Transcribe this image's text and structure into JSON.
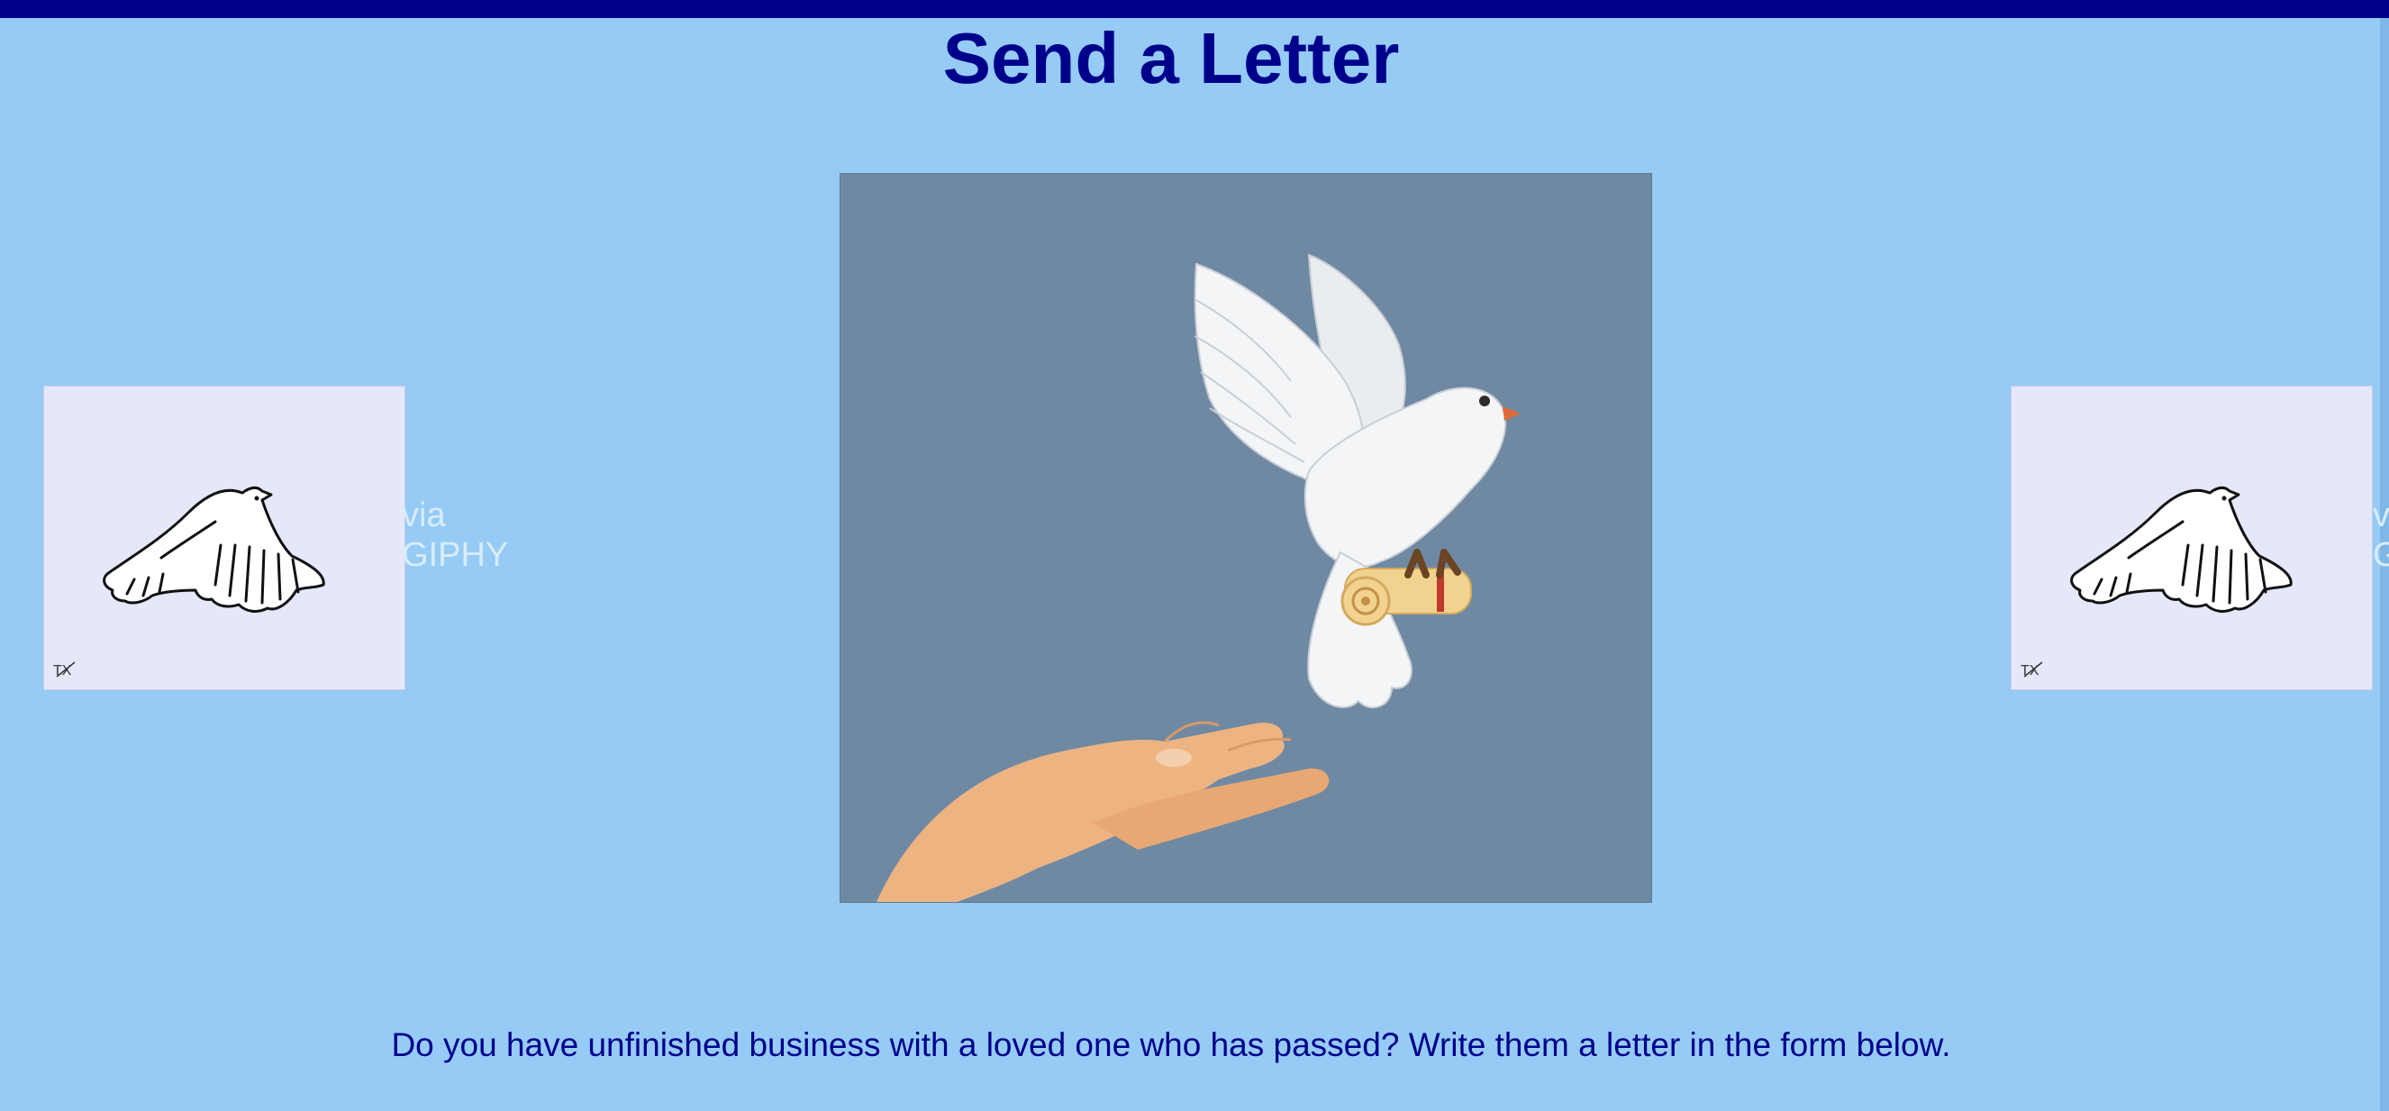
{
  "page": {
    "title": "Send a Letter",
    "intro": "Do you have unfinished business with a loved one who has passed? Write them a letter in the form below."
  },
  "hero_image": {
    "icon": "dove-with-scroll-and-hand-illustration"
  },
  "side_gifs": {
    "left": {
      "icon": "flying-dove-line-drawing",
      "credit_line1": "via",
      "credit_line2": "GIPHY"
    },
    "right": {
      "icon": "flying-dove-line-drawing",
      "credit_line1": "via",
      "credit_line2": "GIPHY"
    }
  },
  "colors": {
    "background": "#95cbf5",
    "accent": "#00008b",
    "hero_bg": "#6f89a3",
    "gif_bg": "#e5e8fb"
  }
}
